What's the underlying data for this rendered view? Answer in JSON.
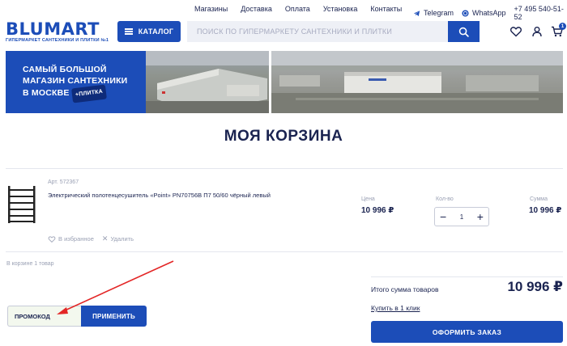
{
  "topnav": {
    "links": [
      "Магазины",
      "Доставка",
      "Оплата",
      "Установка",
      "Контакты"
    ],
    "telegram": "Telegram",
    "whatsapp": "WhatsApp",
    "phone": "+7 495 540-51-52"
  },
  "header": {
    "logo": "BLUMART",
    "tagline": "ГИПЕРМАРКЕТ САНТЕХНИКИ И ПЛИТКИ №1",
    "catalog_label": "КАТАЛОГ",
    "search_placeholder": "ПОИСК ПО ГИПЕРМАРКЕТУ САНТЕХНИКИ И ПЛИТКИ",
    "cart_count": "1"
  },
  "banner": {
    "line1": "САМЫЙ БОЛЬШОЙ",
    "line2": "МАГАЗИН САНТЕХНИКИ",
    "line3": "В МОСКВЕ",
    "pill": "+ПЛИТКА"
  },
  "page_title": "МОЯ КОРЗИНА",
  "product": {
    "article": "Арт. 572367",
    "name": "Электрический полотенцесушитель «Point» PN70756B П7 50/60 чёрный левый",
    "price_label": "Цена",
    "price": "10 996 ₽",
    "qty_label": "Кол-во",
    "qty": "1",
    "sum_label": "Сумма",
    "sum": "10 996 ₽",
    "favorite_label": "В избранное",
    "delete_label": "Удалить"
  },
  "cart_info": "В корзине 1 товар",
  "totals": {
    "label": "Итого сумма товаров",
    "value": "10 996 ₽",
    "one_click": "Купить в 1 клик",
    "order_button": "ОФОРМИТЬ ЗАКАЗ"
  },
  "promo": {
    "placeholder": "ПРОМОКОД",
    "apply_label": "ПРИМЕНИТЬ"
  },
  "colors": {
    "brand_blue": "#1c4db8",
    "text_dark": "#1a2350",
    "annotation_red": "#e32626"
  }
}
